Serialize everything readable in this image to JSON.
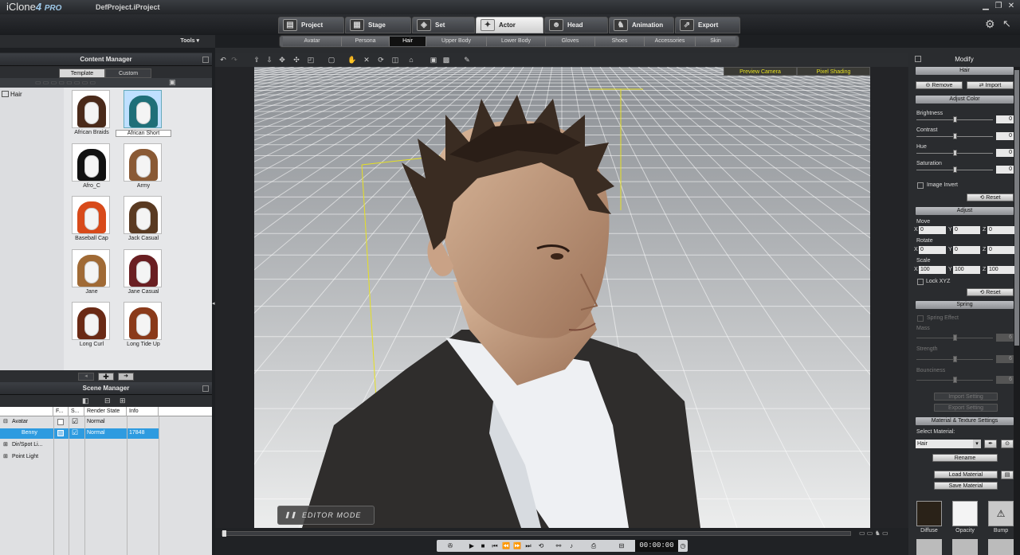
{
  "app": {
    "name": "iClone",
    "version": "4",
    "edition": "PRO",
    "project": "DefProject.iProject"
  },
  "main_tabs": [
    {
      "label": "Project"
    },
    {
      "label": "Stage"
    },
    {
      "label": "Set"
    },
    {
      "label": "Actor"
    },
    {
      "label": "Head"
    },
    {
      "label": "Animation"
    },
    {
      "label": "Export"
    }
  ],
  "tools_label": "Tools ▾",
  "sub_tabs": [
    {
      "label": "Avatar"
    },
    {
      "label": "Persona"
    },
    {
      "label": "Hair"
    },
    {
      "label": "Upper Body"
    },
    {
      "label": "Lower Body"
    },
    {
      "label": "Gloves"
    },
    {
      "label": "Shoes"
    },
    {
      "label": "Accessories"
    },
    {
      "label": "Skin"
    }
  ],
  "content_manager": {
    "title": "Content Manager",
    "tabs": [
      "Template",
      "Custom"
    ],
    "tree": [
      "Hair"
    ],
    "items": [
      {
        "label": "African Braids",
        "color": "#4a2a1a"
      },
      {
        "label": "African Short",
        "color": "#1f6f78"
      },
      {
        "label": "Afro_C",
        "color": "#111111"
      },
      {
        "label": "Army",
        "color": "#8a5a35"
      },
      {
        "label": "Baseball Cap",
        "color": "#d84a1a"
      },
      {
        "label": "Jack Casual",
        "color": "#5a3a22"
      },
      {
        "label": "Jane",
        "color": "#a06a35"
      },
      {
        "label": "Jane Casual",
        "color": "#6a1f22"
      },
      {
        "label": "Long Curl",
        "color": "#6a2a15"
      },
      {
        "label": "Long Tide Up",
        "color": "#8a3a1a"
      }
    ]
  },
  "scene_manager": {
    "title": "Scene Manager",
    "columns": [
      "",
      "F...",
      "S...",
      "Render State",
      "Info"
    ],
    "rows": [
      {
        "name": "Avatar",
        "render": "Normal",
        "info": ""
      },
      {
        "name": "Benny",
        "render": "Normal",
        "info": "17848"
      },
      {
        "name": "Dir/Spot Li...",
        "render": "",
        "info": ""
      },
      {
        "name": "Point Light",
        "render": "",
        "info": ""
      }
    ]
  },
  "viewport": {
    "badges": [
      "Preview Camera",
      "Pixel Shading"
    ],
    "mode_label": "EDITOR MODE"
  },
  "timeline": {
    "timecode": "00:00:00"
  },
  "modify": {
    "title": "Modify",
    "section_hair": "Hair",
    "remove_label": "Remove",
    "import_label": "Import",
    "adjust_color": "Adjust Color",
    "sliders": [
      {
        "label": "Brightness",
        "value": "0"
      },
      {
        "label": "Contrast",
        "value": "0"
      },
      {
        "label": "Hue",
        "value": "0"
      },
      {
        "label": "Saturation",
        "value": "0"
      }
    ],
    "image_invert": "Image Invert",
    "reset_label": "Reset",
    "adjust": "Adjust",
    "move": "Move",
    "rotate": "Rotate",
    "scale": "Scale",
    "move_vals": [
      "0",
      "0",
      "0"
    ],
    "rotate_vals": [
      "0",
      "0",
      "0"
    ],
    "scale_vals": [
      "100",
      "100",
      "100"
    ],
    "lock_xyz": "Lock XYZ",
    "spring": "Spring",
    "spring_effect": "Spring Effect",
    "spring_sliders": [
      {
        "label": "Mass",
        "value": "6"
      },
      {
        "label": "Strength",
        "value": "6"
      },
      {
        "label": "Bounciness",
        "value": "6"
      }
    ],
    "import_setting": "Import Setting",
    "export_setting": "Export Setting",
    "material_section": "Material & Texture Settings",
    "select_material": "Select Material:",
    "material_value": "Hair",
    "rename": "Rename",
    "load_material": "Load Material",
    "save_material": "Save Material",
    "textures": [
      "Diffuse",
      "Opacity",
      "Bump"
    ]
  }
}
